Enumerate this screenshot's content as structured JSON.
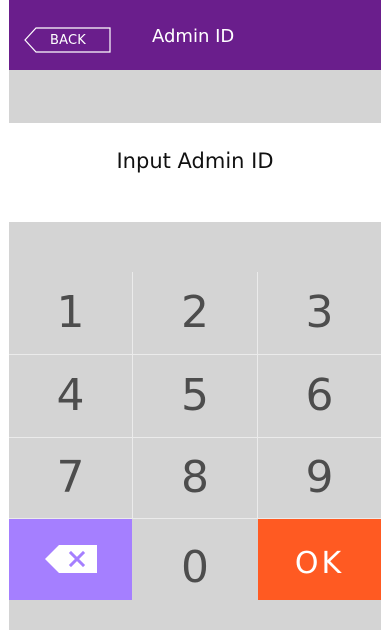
{
  "header": {
    "back_label": "BACK",
    "title": "Admin ID",
    "background": "#6a1e8c"
  },
  "prompt": {
    "text": "Input Admin ID"
  },
  "keypad": {
    "digits": [
      "1",
      "2",
      "3",
      "4",
      "5",
      "6",
      "7",
      "8",
      "9",
      "0"
    ],
    "delete_icon": "backspace-icon",
    "ok_label": "OK",
    "delete_color": "#a57fff",
    "ok_color": "#ff5a22",
    "key_color": "#d4d4d4"
  }
}
